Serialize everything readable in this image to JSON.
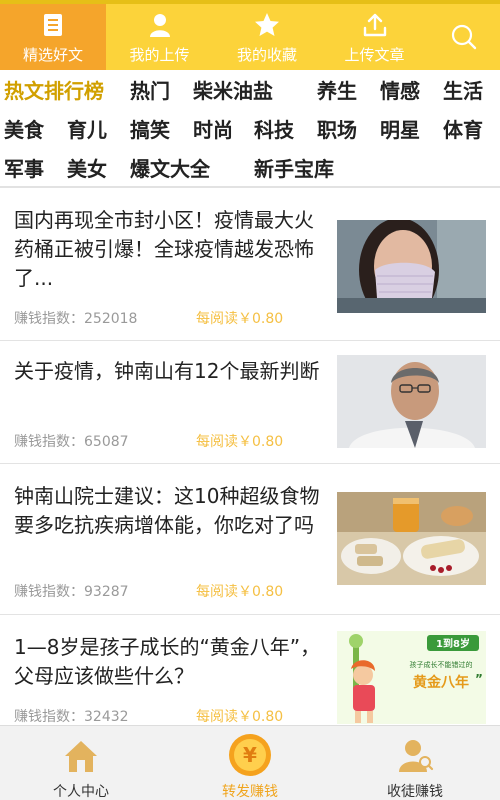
{
  "top_tabs": [
    {
      "label": "精选好文",
      "icon": "document-icon",
      "active": true
    },
    {
      "label": "我的上传",
      "icon": "user-icon",
      "active": false
    },
    {
      "label": "我的收藏",
      "icon": "star-icon",
      "active": false
    },
    {
      "label": "上传文章",
      "icon": "upload-icon",
      "active": false
    },
    {
      "label": "",
      "icon": "search-icon",
      "active": false
    }
  ],
  "categories": [
    "热文排行榜",
    "热门",
    "柴米油盐",
    "养生",
    "情感",
    "生活",
    "美食",
    "育儿",
    "搞笑",
    "时尚",
    "科技",
    "职场",
    "明星",
    "体育",
    "军事",
    "美女",
    "爆文大全",
    "新手宝库"
  ],
  "active_category": "热文排行榜",
  "articles": [
    {
      "title": "国内再现全市封小区！疫情最大火药桶正被引爆！全球疫情越发恐怖了...",
      "index_label": "赚钱指数：",
      "index_value": "252018",
      "reward": "每阅读￥0.80",
      "thumb": "masked-woman-photo"
    },
    {
      "title": "关于疫情，钟南山有12个最新判断",
      "index_label": "赚钱指数：",
      "index_value": "65087",
      "reward": "每阅读￥0.80",
      "thumb": "doctor-portrait-photo"
    },
    {
      "title": "钟南山院士建议：这10种超级食物要多吃抗疾病增体能，你吃对了吗",
      "index_label": "赚钱指数：",
      "index_value": "93287",
      "reward": "每阅读￥0.80",
      "thumb": "food-photo"
    },
    {
      "title": "1—8岁是孩子成长的“黄金八年”，父母应该做些什么？",
      "index_label": "赚钱指数：",
      "index_value": "32432",
      "reward": "每阅读￥0.80",
      "thumb": "cartoon-banner-image",
      "thumb_text": {
        "line1": "1到8岁",
        "line2": "孩子成长不能错过的",
        "line3": "黄金八年",
        "quote": "”"
      }
    }
  ],
  "bottom_nav": [
    {
      "label": "个人中心",
      "icon": "house-icon",
      "active": false
    },
    {
      "label": "转发赚钱",
      "icon": "yen-coin-icon",
      "active": true,
      "coin_symbol": "¥"
    },
    {
      "label": "收徒赚钱",
      "icon": "person-icon",
      "active": false
    }
  ],
  "colors": {
    "topbar": "#fcd33a",
    "active_tab": "#f5a52b",
    "active_category": "#d1a000",
    "reward": "#f5c044",
    "meta": "#9a9a9a",
    "bottom_active": "#f0a51e",
    "bottom_icon": "#e3b35e"
  }
}
